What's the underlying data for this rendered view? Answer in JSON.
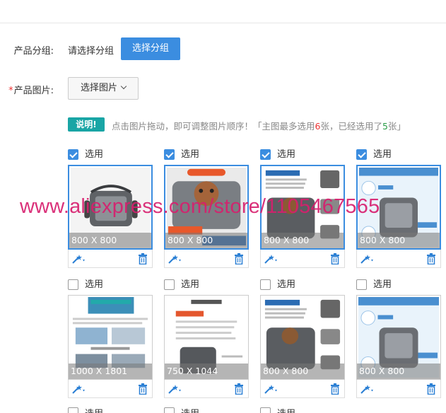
{
  "form": {
    "group_label": "产品分组:",
    "group_value": "请选择分组",
    "group_button": "选择分组",
    "image_label_required": "*",
    "image_label": "产品图片:",
    "image_button": "选择图片"
  },
  "hint": {
    "badge": "说明!",
    "text_a": "点击图片拖动，即可调整图片顺序！「主图最多选用",
    "max": "6",
    "text_b": "张，已经选用了",
    "used": "5",
    "text_c": "张」"
  },
  "images": [
    {
      "checked": true,
      "label": "选用",
      "size": "800 X 800"
    },
    {
      "checked": true,
      "label": "选用",
      "size": "800 X 800"
    },
    {
      "checked": true,
      "label": "选用",
      "size": "800 X 800"
    },
    {
      "checked": true,
      "label": "选用",
      "size": "800 X 800"
    },
    {
      "checked": false,
      "label": "选用",
      "size": "1000 X 1801"
    },
    {
      "checked": false,
      "label": "选用",
      "size": "750 X 1044"
    },
    {
      "checked": false,
      "label": "选用",
      "size": "800 X 800"
    },
    {
      "checked": false,
      "label": "选用",
      "size": "800 X 800"
    }
  ],
  "peek_labels": [
    "选用",
    "选用",
    "选用"
  ],
  "watermark": "www.aliexpress.com/store/1105467565",
  "colors": {
    "accent": "#3b8de0",
    "badge": "#19a5a5",
    "required": "#e33333",
    "watermark": "#d71e6e"
  }
}
